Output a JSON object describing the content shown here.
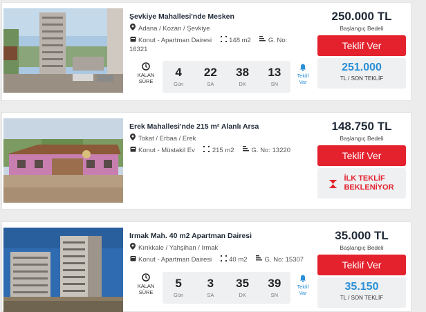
{
  "listings": [
    {
      "title": "Şevkiye Mahallesi'nde Mesken",
      "location": "Adana / Kozan / Şevkiye",
      "type": "Konut - Apartman Dairesi",
      "area": "148 m2",
      "gno_line1": "G. No:",
      "gno_line2": "16321",
      "price": "250.000 TL",
      "price_label": "Başlangıç Bedeli",
      "button": "Teklif Ver",
      "kalan_label_1": "KALAN",
      "kalan_label_2": "SÜRE",
      "timer": [
        {
          "value": "4",
          "unit": "Gün"
        },
        {
          "value": "22",
          "unit": "SA"
        },
        {
          "value": "38",
          "unit": "DK"
        },
        {
          "value": "13",
          "unit": "SN"
        }
      ],
      "bell_1": "Teklif",
      "bell_2": "Var",
      "last_bid": "251.000",
      "last_bid_label": "TL / SON TEKLİF"
    },
    {
      "title": "Erek Mahallesi'nde 215 m² Alanlı Arsa",
      "location": "Tokat / Erbaa / Erek",
      "type": "Konut - Müstakil Ev",
      "area": "215 m2",
      "gno": "G. No: 13220",
      "price": "148.750 TL",
      "price_label": "Başlangıç Bedeli",
      "button": "Teklif Ver",
      "waiting_1": "İLK TEKLİF",
      "waiting_2": "BEKLENİYOR"
    },
    {
      "title": "Irmak Mah. 40 m2 Apartman Dairesi",
      "location": "Kırıkkale / Yahşihan / Irmak",
      "type": "Konut - Apartman Dairesi",
      "area": "40 m2",
      "gno": "G. No: 15307",
      "price": "35.000 TL",
      "price_label": "Başlangıç Bedeli",
      "button": "Teklif Ver",
      "kalan_label_1": "KALAN",
      "kalan_label_2": "SÜRE",
      "timer": [
        {
          "value": "5",
          "unit": "Gün"
        },
        {
          "value": "3",
          "unit": "SA"
        },
        {
          "value": "35",
          "unit": "DK"
        },
        {
          "value": "39",
          "unit": "SN"
        }
      ],
      "bell_1": "Teklif",
      "bell_2": "Var",
      "last_bid": "35.150",
      "last_bid_label": "TL / SON TEKLİF"
    }
  ],
  "colors": {
    "accent_red": "#e4222e",
    "accent_blue": "#2a8fd6",
    "panel_gray": "#eef0f2",
    "title_dark": "#1f2937"
  },
  "icons": [
    "map-pin-icon",
    "house-icon",
    "area-icon",
    "gno-icon",
    "clock-icon",
    "bell-icon",
    "hourglass-icon"
  ]
}
